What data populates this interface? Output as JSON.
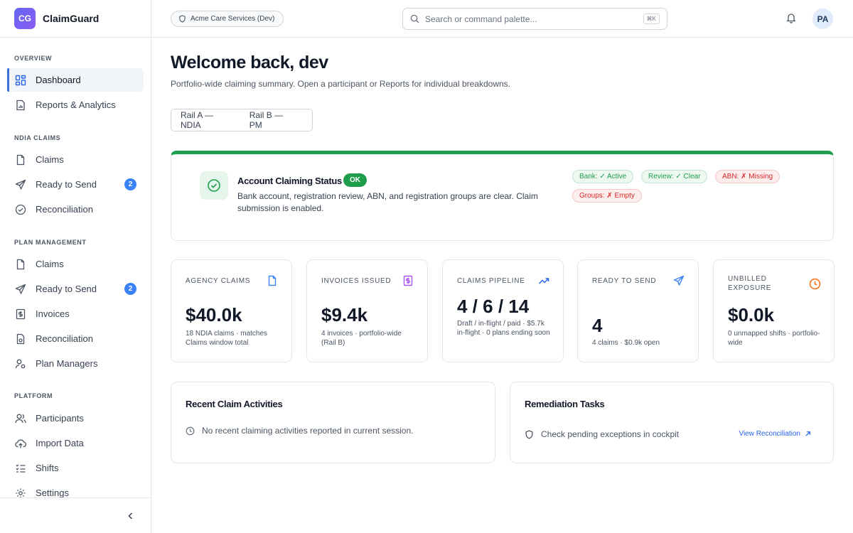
{
  "brand": {
    "logo": "CG",
    "name": "ClaimGuard"
  },
  "sidebar": {
    "sections": [
      {
        "title": "OVERVIEW",
        "items": [
          {
            "label": "Dashboard",
            "icon": "grid-icon",
            "active": true
          },
          {
            "label": "Reports & Analytics",
            "icon": "report-icon"
          }
        ]
      },
      {
        "title": "NDIA CLAIMS",
        "items": [
          {
            "label": "Claims",
            "icon": "document-icon"
          },
          {
            "label": "Ready to Send",
            "icon": "send-icon",
            "badge": "2"
          },
          {
            "label": "Reconciliation",
            "icon": "check-circle-icon"
          }
        ]
      },
      {
        "title": "PLAN MANAGEMENT",
        "items": [
          {
            "label": "Claims",
            "icon": "document-icon"
          },
          {
            "label": "Ready to Send",
            "icon": "send-icon",
            "badge": "2"
          },
          {
            "label": "Invoices",
            "icon": "invoice-icon"
          },
          {
            "label": "Reconciliation",
            "icon": "file-check-icon"
          },
          {
            "label": "Plan Managers",
            "icon": "user-cog-icon"
          }
        ]
      },
      {
        "title": "PLATFORM",
        "items": [
          {
            "label": "Participants",
            "icon": "users-icon"
          },
          {
            "label": "Import Data",
            "icon": "cloud-upload-icon"
          },
          {
            "label": "Shifts",
            "icon": "list-icon"
          },
          {
            "label": "Settings",
            "icon": "gear-icon"
          }
        ]
      }
    ]
  },
  "header": {
    "org": "Acme Care Services (Dev)",
    "search_placeholder": "Search or command palette...",
    "shortcut": "⌘K",
    "avatar": "PA"
  },
  "main": {
    "title": "Welcome back, dev",
    "subtitle": "Portfolio-wide claiming summary. Open a participant or Reports for individual breakdowns.",
    "rails": [
      "Rail A — NDIA",
      "Rail B — PM"
    ]
  },
  "status": {
    "title": "Account Claiming Status",
    "badge": "OK",
    "description": "Bank account, registration review, ABN, and registration groups are clear. Claim submission is enabled.",
    "chips": [
      {
        "label": "Bank: ✓ Active",
        "kind": "good"
      },
      {
        "label": "Review: ✓ Clear",
        "kind": "good"
      },
      {
        "label": "ABN: ✗ Missing",
        "kind": "bad"
      },
      {
        "label": "Groups: ✗ Empty",
        "kind": "bad"
      }
    ]
  },
  "metrics": [
    {
      "label": "AGENCY CLAIMS",
      "value": "$40.0k",
      "note": "18 NDIA claims · matches Claims window total",
      "icon": "document-icon",
      "icon_color": "#3b82f6"
    },
    {
      "label": "INVOICES ISSUED",
      "value": "$9.4k",
      "note": "4 invoices · portfolio-wide (Rail B)",
      "icon": "invoice-icon",
      "icon_color": "#a855f7"
    },
    {
      "label": "CLAIMS PIPELINE",
      "value": "4 / 6 / 14",
      "note": "Draft / in-flight / paid · $5.7k in-flight · 0 plans ending soon",
      "icon": "trending-up-icon",
      "icon_color": "#2563eb"
    },
    {
      "label": "READY TO SEND",
      "value": "4",
      "note": "4 claims · $0.9k open",
      "icon": "send-icon",
      "icon_color": "#3b82f6"
    },
    {
      "label": "UNBILLED EXPOSURE",
      "value": "$0.0k",
      "note": "0 unmapped shifts · portfolio-wide",
      "icon": "clock-icon",
      "icon_color": "#f97316"
    }
  ],
  "panels": {
    "recent": {
      "title": "Recent Claim Activities",
      "empty": "No recent claiming activities reported in current session."
    },
    "remediation": {
      "title": "Remediation Tasks",
      "task": "Check pending exceptions in cockpit",
      "link": "View Reconciliation"
    }
  }
}
